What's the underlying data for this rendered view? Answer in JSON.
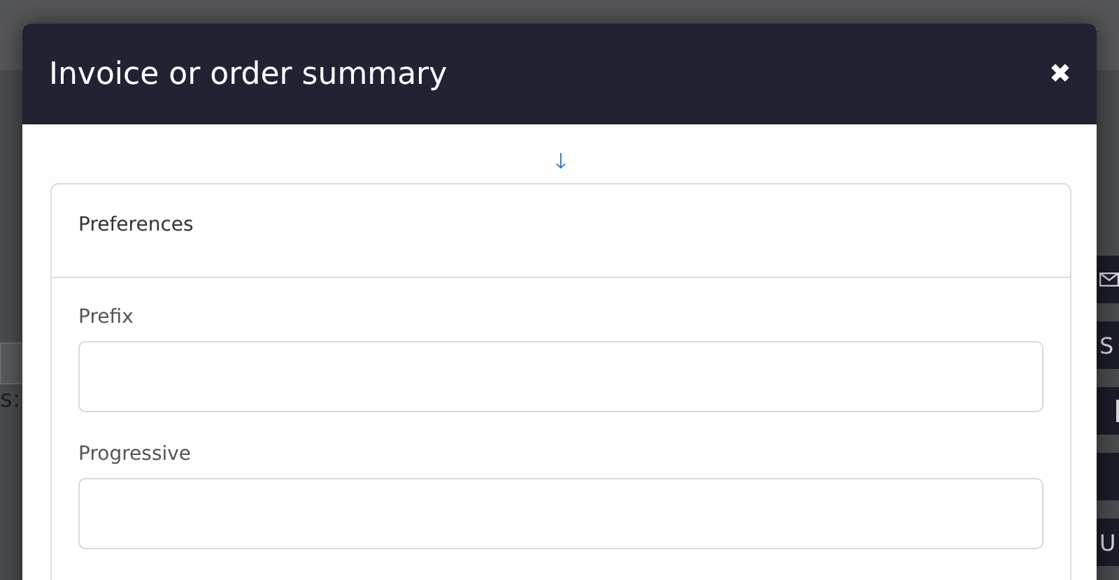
{
  "background": {
    "left_text": "s:",
    "side_buttons": [
      {
        "kind": "mail"
      },
      {
        "kind": "text",
        "label": "S"
      },
      {
        "kind": "bar"
      },
      {
        "kind": "blank"
      },
      {
        "kind": "text",
        "label": "U"
      }
    ]
  },
  "modal": {
    "title": "Invoice or order summary",
    "close": "✖",
    "arrow": "🡓",
    "card": {
      "title": "Preferences",
      "fields": [
        {
          "label": "Prefix"
        },
        {
          "label": "Progressive"
        }
      ]
    }
  }
}
